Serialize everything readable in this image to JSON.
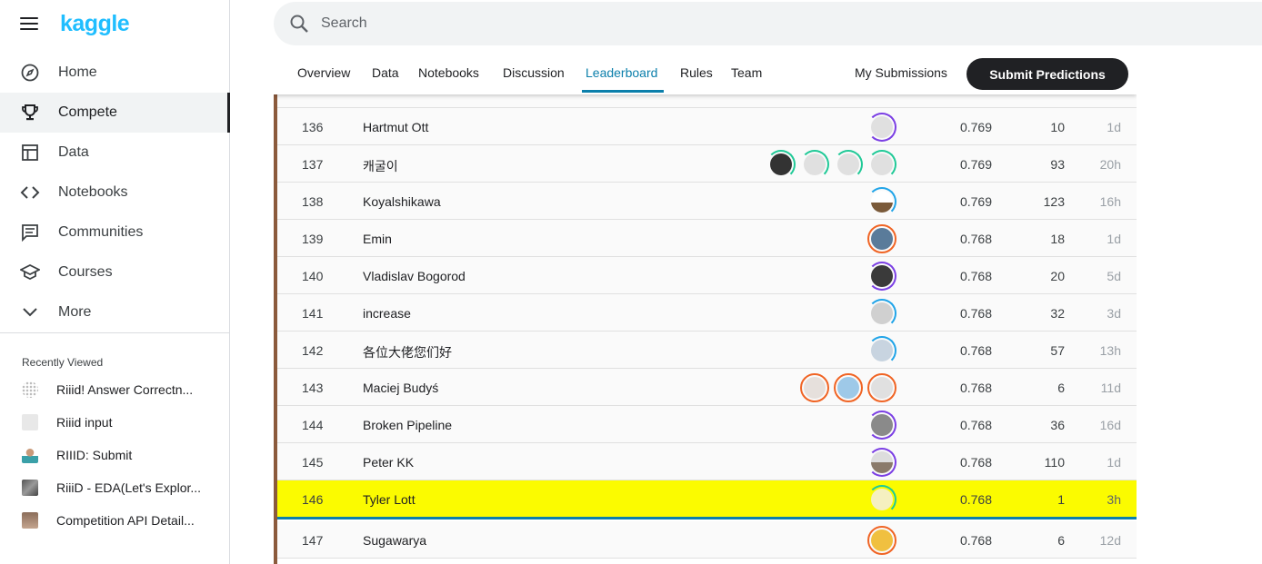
{
  "brand": {
    "logo_text": "kaggle"
  },
  "nav": [
    {
      "label": "Home",
      "icon": "compass-icon",
      "active": false
    },
    {
      "label": "Compete",
      "icon": "trophy-icon",
      "active": true
    },
    {
      "label": "Data",
      "icon": "table-icon",
      "active": false
    },
    {
      "label": "Notebooks",
      "icon": "code-icon",
      "active": false
    },
    {
      "label": "Communities",
      "icon": "chat-icon",
      "active": false
    },
    {
      "label": "Courses",
      "icon": "graduation-cap-icon",
      "active": false
    },
    {
      "label": "More",
      "icon": "chevron-down-icon",
      "active": false
    }
  ],
  "recent": {
    "title": "Recently Viewed",
    "items": [
      {
        "label": "Riiid! Answer Correctn..."
      },
      {
        "label": "Riiid input"
      },
      {
        "label": "RIIID: Submit"
      },
      {
        "label": "RiiiD - EDA(Let's Explor..."
      },
      {
        "label": "Competition API Detail..."
      }
    ]
  },
  "search": {
    "placeholder": "Search"
  },
  "tabs": [
    {
      "label": "Overview"
    },
    {
      "label": "Data"
    },
    {
      "label": "Notebooks"
    },
    {
      "label": "Discussion"
    },
    {
      "label": "Leaderboard",
      "active": true
    },
    {
      "label": "Rules"
    },
    {
      "label": "Team"
    }
  ],
  "actions": {
    "my_submissions": "My Submissions",
    "submit": "Submit Predictions"
  },
  "colors": {
    "accent": "#0b7fab",
    "highlight": "#fbfb00",
    "brand": "#20beff"
  },
  "leaderboard": [
    {
      "rank": "136",
      "name": "Hartmut Ott",
      "score": "0.769",
      "entries": "10",
      "last": "1d"
    },
    {
      "rank": "137",
      "name": "캐굴이",
      "score": "0.769",
      "entries": "93",
      "last": "20h"
    },
    {
      "rank": "138",
      "name": "Koyalshikawa",
      "score": "0.769",
      "entries": "123",
      "last": "16h"
    },
    {
      "rank": "139",
      "name": "Emin",
      "score": "0.768",
      "entries": "18",
      "last": "1d"
    },
    {
      "rank": "140",
      "name": "Vladislav Bogorod",
      "score": "0.768",
      "entries": "20",
      "last": "5d"
    },
    {
      "rank": "141",
      "name": "increase",
      "score": "0.768",
      "entries": "32",
      "last": "3d"
    },
    {
      "rank": "142",
      "name": "各位大佬您们好",
      "score": "0.768",
      "entries": "57",
      "last": "13h"
    },
    {
      "rank": "143",
      "name": "Maciej Budyś",
      "score": "0.768",
      "entries": "6",
      "last": "11d"
    },
    {
      "rank": "144",
      "name": "Broken Pipeline",
      "score": "0.768",
      "entries": "36",
      "last": "16d"
    },
    {
      "rank": "145",
      "name": "Peter KK",
      "score": "0.768",
      "entries": "110",
      "last": "1d"
    },
    {
      "rank": "146",
      "name": "Tyler Lott",
      "score": "0.768",
      "entries": "1",
      "last": "3h"
    },
    {
      "rank": "147",
      "name": "Sugawarya",
      "score": "0.768",
      "entries": "6",
      "last": "12d"
    }
  ]
}
